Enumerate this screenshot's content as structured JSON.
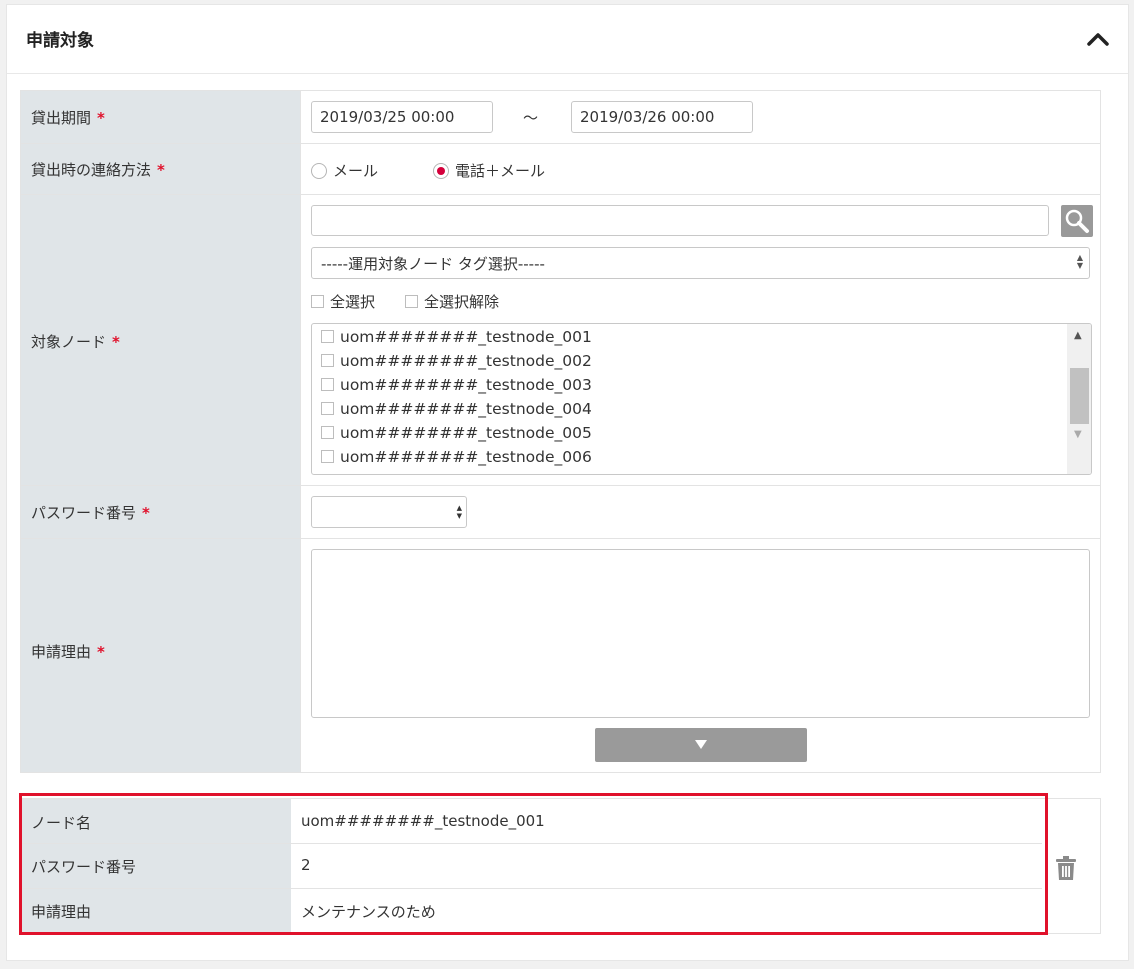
{
  "section": {
    "title": "申請対象"
  },
  "form": {
    "loan_period": {
      "label": "貸出期間",
      "required": "*",
      "start": "2019/03/25 00:00",
      "separator": "～",
      "end": "2019/03/26 00:00"
    },
    "contact_method": {
      "label": "貸出時の連絡方法",
      "required": "*",
      "options": [
        "メール",
        "電話＋メール"
      ],
      "selected": "電話＋メール"
    },
    "target_node": {
      "label": "対象ノード",
      "required": "*",
      "search_value": "",
      "tag_select": "-----運用対象ノード タグ選択-----",
      "select_all": "全選択",
      "deselect_all": "全選択解除",
      "nodes": [
        "uom########_testnode_001",
        "uom########_testnode_002",
        "uom########_testnode_003",
        "uom########_testnode_004",
        "uom########_testnode_005",
        "uom########_testnode_006"
      ]
    },
    "password_number": {
      "label": "パスワード番号",
      "required": "*",
      "value": ""
    },
    "reason": {
      "label": "申請理由",
      "required": "*",
      "value": ""
    }
  },
  "summary": {
    "rows": [
      {
        "label": "ノード名",
        "value": "uom########_testnode_001"
      },
      {
        "label": "パスワード番号",
        "value": "2"
      },
      {
        "label": "申請理由",
        "value": "メンテナンスのため"
      }
    ]
  },
  "colors": {
    "required": "#e0112b",
    "radio_selected": "#d4003b",
    "label_bg": "#e0e5e8",
    "highlight": "#e0112b"
  },
  "icons": {
    "collapse": "chevron-up-icon",
    "search": "search-icon",
    "down": "triangle-down-icon",
    "delete": "trash-icon"
  }
}
